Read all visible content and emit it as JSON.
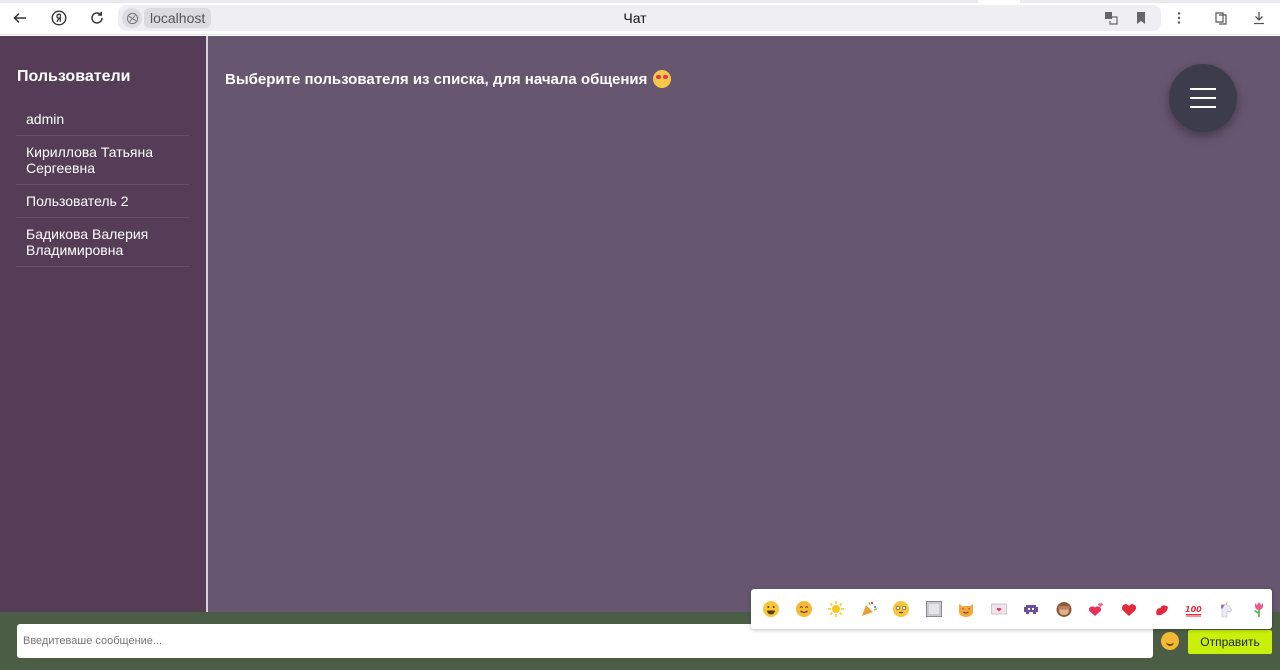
{
  "browser": {
    "url_host": "localhost",
    "tab_title": "Чат"
  },
  "sidebar": {
    "heading": "Пользователи",
    "users": [
      {
        "name": "admin"
      },
      {
        "name": "Кириллова Татьяна Сергеевна"
      },
      {
        "name": "Пользователь 2"
      },
      {
        "name": "Бадикова Валерия Владимировна"
      }
    ]
  },
  "main": {
    "prompt": "Выберите пользователя из списка, для начала общения"
  },
  "composer": {
    "placeholder": "Введитеваше сообщение...",
    "send_label": "Отправить"
  },
  "emoji_panel": {
    "icons": [
      "grinning-face-icon",
      "smiling-face-icon",
      "sun-icon",
      "party-popper-icon",
      "flushed-face-icon",
      "picture-frame-icon",
      "smiling-cat-heart-eyes-icon",
      "love-letter-icon",
      "alien-monster-icon",
      "see-no-evil-monkey-icon",
      "two-hearts-icon",
      "red-heart-icon",
      "kiss-mark-icon",
      "hundred-points-icon",
      "unicorn-icon",
      "tulip-icon"
    ]
  },
  "colors": {
    "sidebar": "#553d57",
    "main": "#665670",
    "input_bar": "#4b5e45",
    "send_button": "#c8f00a",
    "menu_button": "#3c3c4c"
  }
}
